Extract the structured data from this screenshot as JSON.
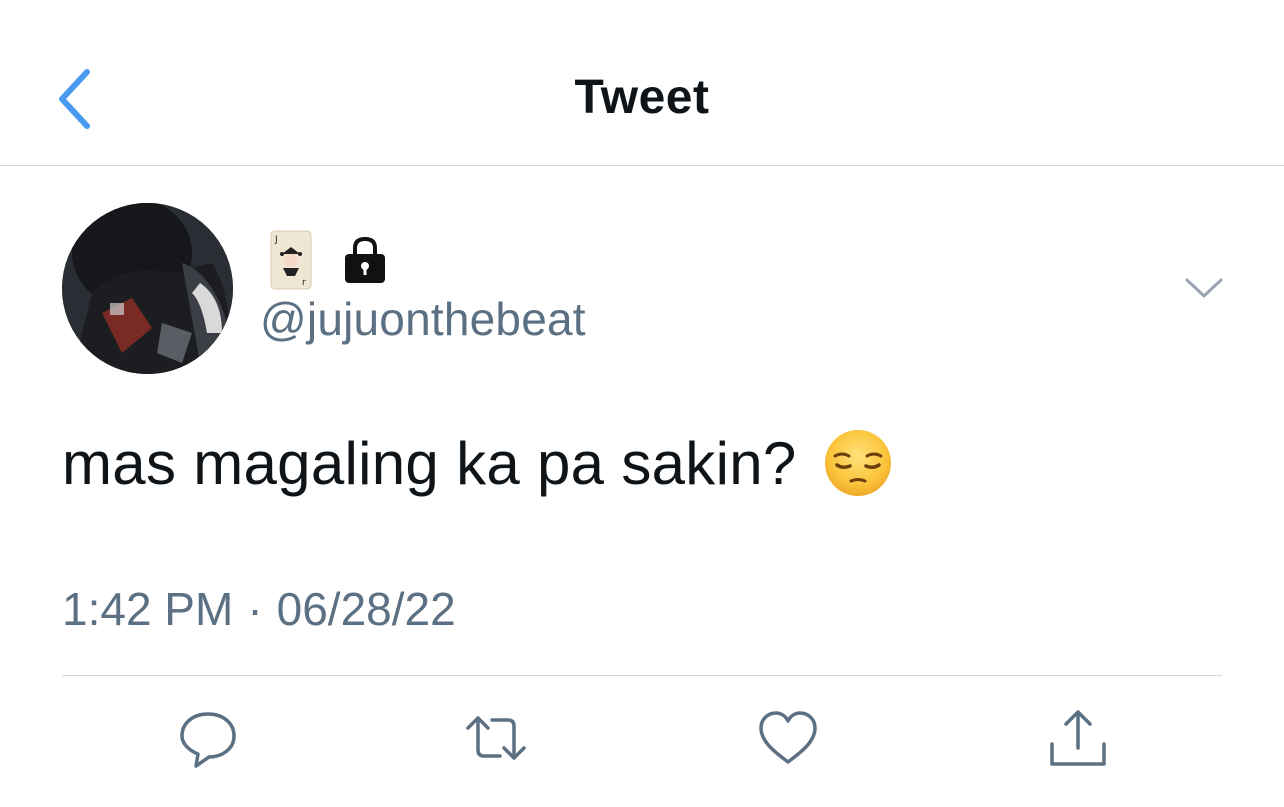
{
  "header": {
    "title": "Tweet",
    "back_icon": "chevron-left-icon"
  },
  "author": {
    "display_emoji_icons": [
      "joker-card-icon",
      "lock-icon"
    ],
    "handle": "@jujuonthebeat",
    "menu_icon": "chevron-down-icon"
  },
  "tweet": {
    "text": "mas magaling ka pa sakin?",
    "emoji_icon": "pensive-face-icon"
  },
  "meta": {
    "time": "1:42 PM",
    "separator": "·",
    "date": "06/28/22"
  },
  "actions": [
    "reply-icon",
    "retweet-icon",
    "like-icon",
    "share-icon"
  ],
  "colors": {
    "accent": "#1d9bf0",
    "text": "#0f1419",
    "secondary": "#5b7083",
    "divider": "#d5d7da"
  }
}
